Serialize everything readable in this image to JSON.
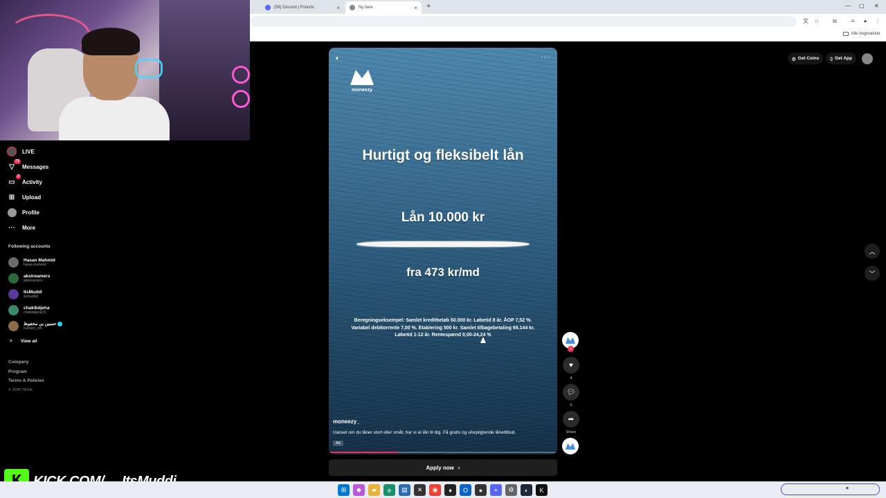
{
  "browser": {
    "tabs": [
      {
        "label": "(58) Discord | Friends",
        "active": false
      },
      {
        "label": "Ny fane",
        "active": true
      }
    ],
    "bookmarks_label": "Alle bogmærker"
  },
  "sidebar": {
    "nav": [
      {
        "label": "LIVE",
        "icon": "live-icon"
      },
      {
        "label": "Messages",
        "icon": "paper-plane-icon",
        "badge": "71"
      },
      {
        "label": "Activity",
        "icon": "inbox-icon",
        "badge": "3"
      },
      {
        "label": "Upload",
        "icon": "plus-square-icon"
      },
      {
        "label": "Profile",
        "icon": "avatar-icon"
      },
      {
        "label": "More",
        "icon": "ellipsis-icon"
      }
    ],
    "following_title": "Following accounts",
    "accounts": [
      {
        "name": "Hasan Mahmid",
        "handle": "hasan.mahmid"
      },
      {
        "name": "akstreamers",
        "handle": "akstreamers"
      },
      {
        "name": "ItsMuddi",
        "handle": "itsmuddi2"
      },
      {
        "name": "chakibdjeha",
        "handle": "chakibdjeha79"
      },
      {
        "name": "حسين بن محفوظ",
        "handle": "hussein_sm"
      }
    ],
    "view_all": "View all",
    "footer": [
      "Company",
      "Program",
      "Terms & Policies",
      "© 2026 TikTok"
    ]
  },
  "video": {
    "brand": "moneezy",
    "headline": "Hurtigt og fleksibelt lån",
    "loan_amount": "Lån 10.000 kr",
    "monthly": "fra 473 kr/md",
    "fineprint": "Beregningseksempel: Samlet kreditbeløb 50.000 kr. Løbetid 8 år. ÅOP 7,52 %. Variabel debitorrente 7,00 %. Etablering 500 kr. Samlet tilbagebetaling 66.144 kr. Løbetid 1-12 år. Rentespænd 0,00-24,24 %",
    "username": "moneezy_",
    "caption": "Uanset om du låner stort eller småt, har vi et lån til dig. Få gratis og uforpligtende lånetilbud.",
    "ad_label": "Ad",
    "progress": 0.3,
    "cta": "Apply now"
  },
  "actions": {
    "like_count": "4",
    "comment_count": "0",
    "share_label": "Share"
  },
  "topbar": {
    "get_coins": "Get Coins",
    "get_app": "Get App"
  },
  "overlay": {
    "kick_text": "KICK.COM/",
    "kick_user": "ItsMuddi"
  },
  "colors": {
    "accent": "#fe2c55",
    "kick_green": "#53fc18"
  }
}
